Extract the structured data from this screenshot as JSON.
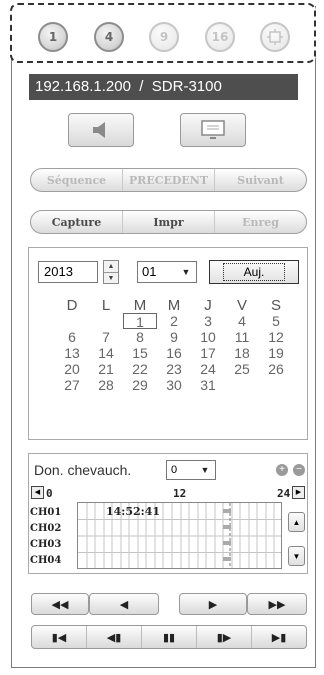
{
  "split_buttons": [
    {
      "label": "1",
      "icon": "split-1-icon",
      "dim": false
    },
    {
      "label": "4",
      "icon": "split-4-icon",
      "dim": false
    },
    {
      "label": "9",
      "icon": "split-9-icon",
      "dim": true
    },
    {
      "label": "16",
      "icon": "split-16-icon",
      "dim": true
    },
    {
      "label": "",
      "icon": "fullscreen-icon",
      "dim": true
    }
  ],
  "address": {
    "ip": "192.168.1.200",
    "separator": "/",
    "model": "SDR-3100"
  },
  "audio_button": {
    "icon": "speaker-icon"
  },
  "display_button": {
    "icon": "monitor-icon"
  },
  "nav_row": {
    "sequence": "Séquence",
    "previous": "PRECEDENT",
    "next": "Suivant"
  },
  "action_row": {
    "capture": "Capture",
    "print": "Impr",
    "record": "Enreg"
  },
  "calendar": {
    "year": "2013",
    "month": "01",
    "today_label": "Auj.",
    "weekdays": [
      "D",
      "L",
      "M",
      "M",
      "J",
      "V",
      "S"
    ],
    "weeks": [
      [
        "",
        "",
        "1",
        "2",
        "3",
        "4",
        "5"
      ],
      [
        "6",
        "7",
        "8",
        "9",
        "10",
        "11",
        "12"
      ],
      [
        "13",
        "14",
        "15",
        "16",
        "17",
        "18",
        "19"
      ],
      [
        "20",
        "21",
        "22",
        "23",
        "24",
        "25",
        "26"
      ],
      [
        "27",
        "28",
        "29",
        "30",
        "31",
        "",
        ""
      ]
    ],
    "selected_day": "1"
  },
  "timeline": {
    "overlap_label": "Don. chevauch.",
    "overlap_value": "0",
    "ticks": [
      "0",
      "12",
      "24"
    ],
    "channels": [
      "CH01",
      "CH02",
      "CH03",
      "CH04"
    ],
    "current_time": "14:52:41"
  },
  "playback": {
    "rewind": "◀◀",
    "back": "◀",
    "play": "▶",
    "forward": "▶▶"
  },
  "frame_controls": {
    "first": "▮◀",
    "prev_frame": "◀▮",
    "pause": "▮▮",
    "next_frame": "▮▶",
    "last": "▶▮"
  },
  "colors": {
    "address_bg": "#4e4e4e",
    "accent_active": "#4a4a4a",
    "disabled": "#b9b9b9"
  }
}
